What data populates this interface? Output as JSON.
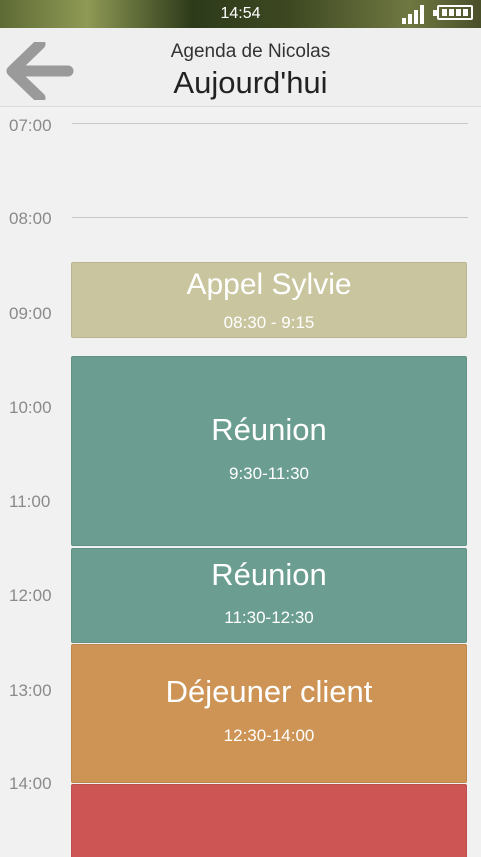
{
  "status_bar": {
    "time": "14:54",
    "icons": [
      "signal-icon",
      "battery-icon"
    ]
  },
  "header": {
    "back_icon": "arrow-left-icon",
    "subtitle": "Agenda de Nicolas",
    "title": "Aujourd'hui"
  },
  "schedule": {
    "hours": [
      "07:00",
      "08:00",
      "09:00",
      "10:00",
      "11:00",
      "12:00",
      "13:00",
      "14:00"
    ],
    "events": [
      {
        "title": "Appel Sylvie",
        "time": "08:30 - 9:15",
        "color": "#c9c59f"
      },
      {
        "title": "Réunion",
        "time": "9:30-11:30",
        "color": "#6b9e91"
      },
      {
        "title": "Réunion",
        "time": "11:30-12:30",
        "color": "#6b9e91"
      },
      {
        "title": "Déjeuner client",
        "time": "12:30-14:00",
        "color": "#cd9455"
      },
      {
        "title": "",
        "time": "",
        "color": "#cd5553"
      }
    ]
  }
}
